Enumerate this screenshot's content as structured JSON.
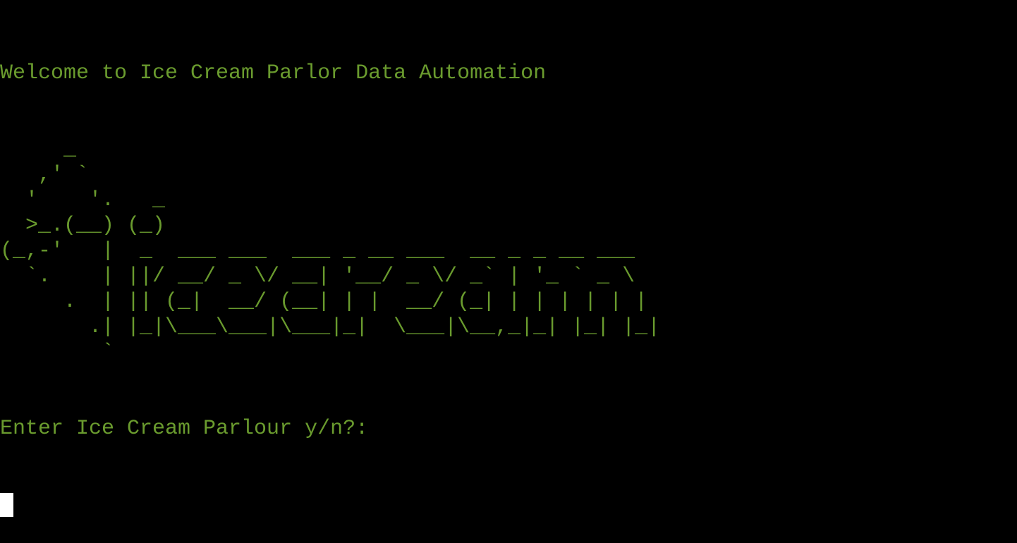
{
  "terminal": {
    "welcome_text": "Welcome to Ice Cream Parlor Data Automation",
    "ascii_art": "     _\n   ,' `\n  '    '.   _\n  >_.(__) (_)\n(_,-'   |  _  ___ ___  ___ _ __ ___  __ _ _ __ ___\n  `.    | ||/ __/ _ \\/ __| '__/ _ \\/ _` | '_ ` _ \\\n     .  | || (_|  __/ (__| | |  __/ (_| | | | | | |\n       .| |_|\\___\\___|\\___|_|  \\___|\\__,_|_| |_| |_|\n        `",
    "prompt_text": "Enter Ice Cream Parlour y/n?:",
    "input_value": ""
  },
  "colors": {
    "background": "#000000",
    "text": "#6a9b2e",
    "cursor": "#ffffff"
  }
}
